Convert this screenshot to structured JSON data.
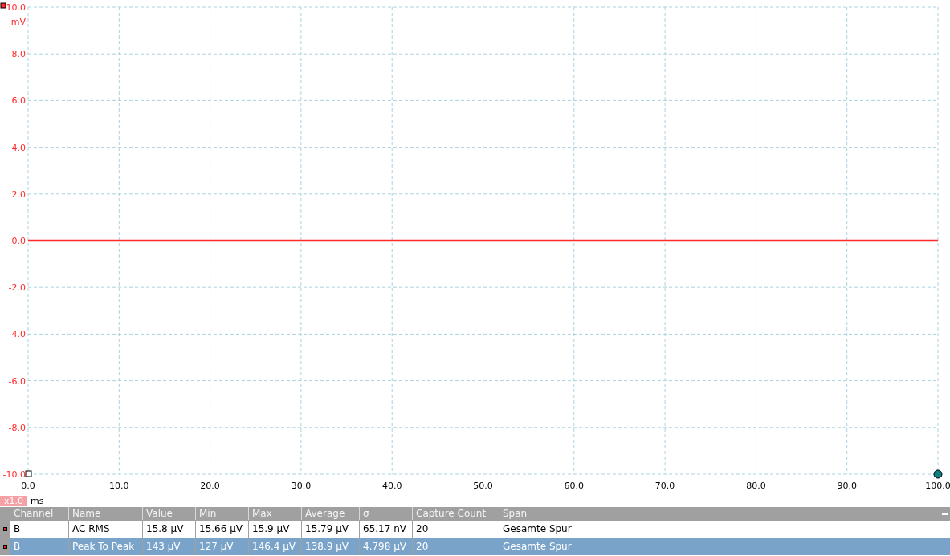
{
  "chart": {
    "zoom_label": "x1.0",
    "chart_data": {
      "type": "line",
      "ylabel": "mV",
      "xlabel": "ms",
      "grid": true,
      "x": [
        0,
        100
      ],
      "xlim": [
        0,
        100
      ],
      "ylim": [
        -10,
        10
      ],
      "xticks": [
        {
          "value": 0,
          "label": "0.0"
        },
        {
          "value": 10,
          "label": "10.0"
        },
        {
          "value": 20,
          "label": "20.0"
        },
        {
          "value": 30,
          "label": "30.0"
        },
        {
          "value": 40,
          "label": "40.0"
        },
        {
          "value": 50,
          "label": "50.0"
        },
        {
          "value": 60,
          "label": "60.0"
        },
        {
          "value": 70,
          "label": "70.0"
        },
        {
          "value": 80,
          "label": "80.0"
        },
        {
          "value": 90,
          "label": "90.0"
        },
        {
          "value": 100,
          "label": "100.0"
        }
      ],
      "yticks": [
        {
          "value": 10,
          "label": "10.0"
        },
        {
          "value": 8,
          "label": "8.0"
        },
        {
          "value": 6,
          "label": "6.0"
        },
        {
          "value": 4,
          "label": "4.0"
        },
        {
          "value": 2,
          "label": "2.0"
        },
        {
          "value": 0,
          "label": "0.0"
        },
        {
          "value": -2,
          "label": "-2.0"
        },
        {
          "value": -4,
          "label": "-4.0"
        },
        {
          "value": -6,
          "label": "-6.0"
        },
        {
          "value": -8,
          "label": "-8.0"
        },
        {
          "value": -10,
          "label": "-10.0"
        }
      ],
      "series": [
        {
          "color": "#ff2a2a",
          "values": [
            0,
            0
          ]
        }
      ]
    }
  },
  "measurements": {
    "columns": [
      "Channel",
      "Name",
      "Value",
      "Min",
      "Max",
      "Average",
      "σ",
      "Capture Count",
      "Span"
    ],
    "rows": [
      {
        "selected": false,
        "cells": [
          "B",
          "AC RMS",
          "15.8 µV",
          "15.66 µV",
          "15.9 µV",
          "15.79 µV",
          "65.17 nV",
          "20",
          "Gesamte Spur"
        ]
      },
      {
        "selected": true,
        "cells": [
          "B",
          "Peak To Peak",
          "143 µV",
          "127 µV",
          "146.4 µV",
          "138.9 µV",
          "4.798 µV",
          "20",
          "Gesamte Spur"
        ]
      }
    ]
  }
}
